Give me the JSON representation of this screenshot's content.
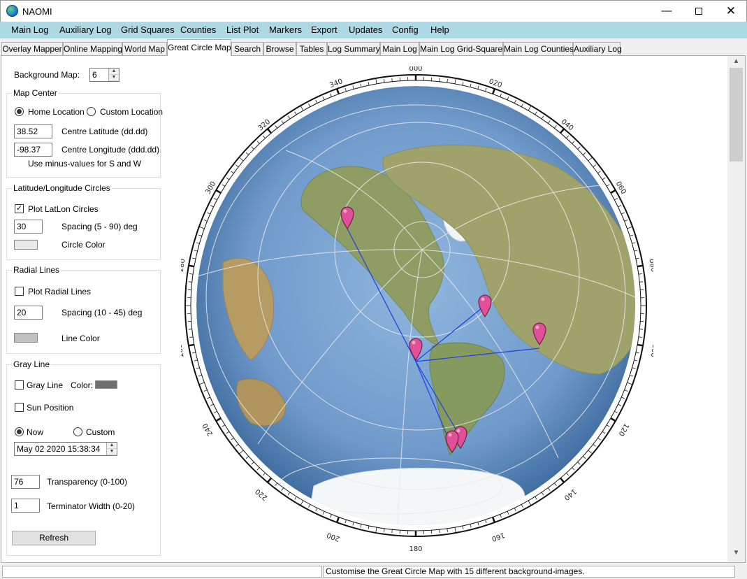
{
  "window": {
    "title": "NAOMI",
    "minimize": "—",
    "close": "✕",
    "icon": "globe-app-icon"
  },
  "menu": [
    "Main Log",
    "Auxiliary Log",
    "Grid Squares",
    "Counties",
    "List Plot",
    "Markers",
    "Export",
    "Updates",
    "Config",
    "Help"
  ],
  "tabs": [
    "Overlay Mapper",
    "Online Mapping",
    "World Map",
    "Great Circle Map",
    "Search",
    "Browse",
    "Tables",
    "Log Summary",
    "Main Log",
    "Main Log Grid-Squares",
    "Main Log Counties",
    "Auxiliary Log"
  ],
  "active_tab": "Great Circle Map",
  "settings": {
    "background_map_label": "Background Map:",
    "background_map_value": "6",
    "map_center": {
      "title": "Map Center",
      "home_location": "Home Location",
      "custom_location": "Custom Location",
      "latitude_value": "38.52",
      "latitude_label": "Centre Latitude (dd.dd)",
      "longitude_value": "-98.37",
      "longitude_label": "Centre Longitude (ddd.dd)",
      "hint": "Use minus-values for S and W"
    },
    "latlon": {
      "title": "Latitude/Longitude Circles",
      "plot_label": "Plot LatLon Circles",
      "spacing_value": "30",
      "spacing_label": "Spacing (5 - 90) deg",
      "color_label": "Circle Color",
      "color": "#e9e9e9"
    },
    "radial": {
      "title": "Radial Lines",
      "plot_label": "Plot Radial Lines",
      "spacing_value": "20",
      "spacing_label": "Spacing (10 - 45) deg",
      "color_label": "Line Color",
      "color": "#c0c0c0"
    },
    "gray_line": {
      "title": "Gray Line",
      "gray_line_label": "Gray Line",
      "color_label": "Color:",
      "color": "#6e6e6e",
      "sun_position": "Sun Position",
      "now": "Now",
      "custom": "Custom",
      "datetime": "May 02 2020    15:38:34",
      "transparency_value": "76",
      "transparency_label": "Transparency (0-100)",
      "terminator_value": "1",
      "terminator_label": "Terminator Width (0-20)"
    },
    "refresh": "Refresh"
  },
  "compass_labels": [
    "000",
    "020",
    "040",
    "060",
    "080",
    "100",
    "120",
    "140",
    "160",
    "180",
    "200",
    "220",
    "240",
    "260",
    "280",
    "300",
    "320",
    "340"
  ],
  "status": {
    "message": "Customise the Great Circle Map with 15 different background-images."
  },
  "colors": {
    "menu_bar": "#add8e6",
    "marker": "#e14f97",
    "path": "#1f3fe0",
    "ocean": "#6c98c8"
  }
}
